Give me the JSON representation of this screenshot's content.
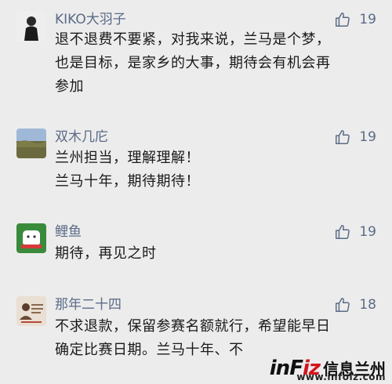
{
  "comments": [
    {
      "username": "KIKO大羽子",
      "likes": "19",
      "lines": [
        "退不退费不要紧，对我来说，兰马是个梦，",
        "也是目标，是家乡的大事，期待会有机会再",
        "参加"
      ]
    },
    {
      "username": "双木几庀",
      "likes": "19",
      "lines": [
        "兰州担当，理解理解！",
        "兰马十年，期待期待！"
      ]
    },
    {
      "username": "鲤鱼",
      "likes": "19",
      "lines": [
        "期待，再见之时"
      ]
    },
    {
      "username": "那年二十四",
      "likes": "18",
      "lines": [
        "不求退款，保留参赛名额就行，希望能早日",
        "确定比赛日期。兰马十年、不"
      ]
    }
  ],
  "watermark": {
    "brand_part1": "inF",
    "brand_part2": "iz",
    "brand_city": "信息兰州",
    "url": "www.infolz.com"
  },
  "icons": {
    "like": "thumbs-up-icon",
    "like_color": "#5b6b87"
  }
}
